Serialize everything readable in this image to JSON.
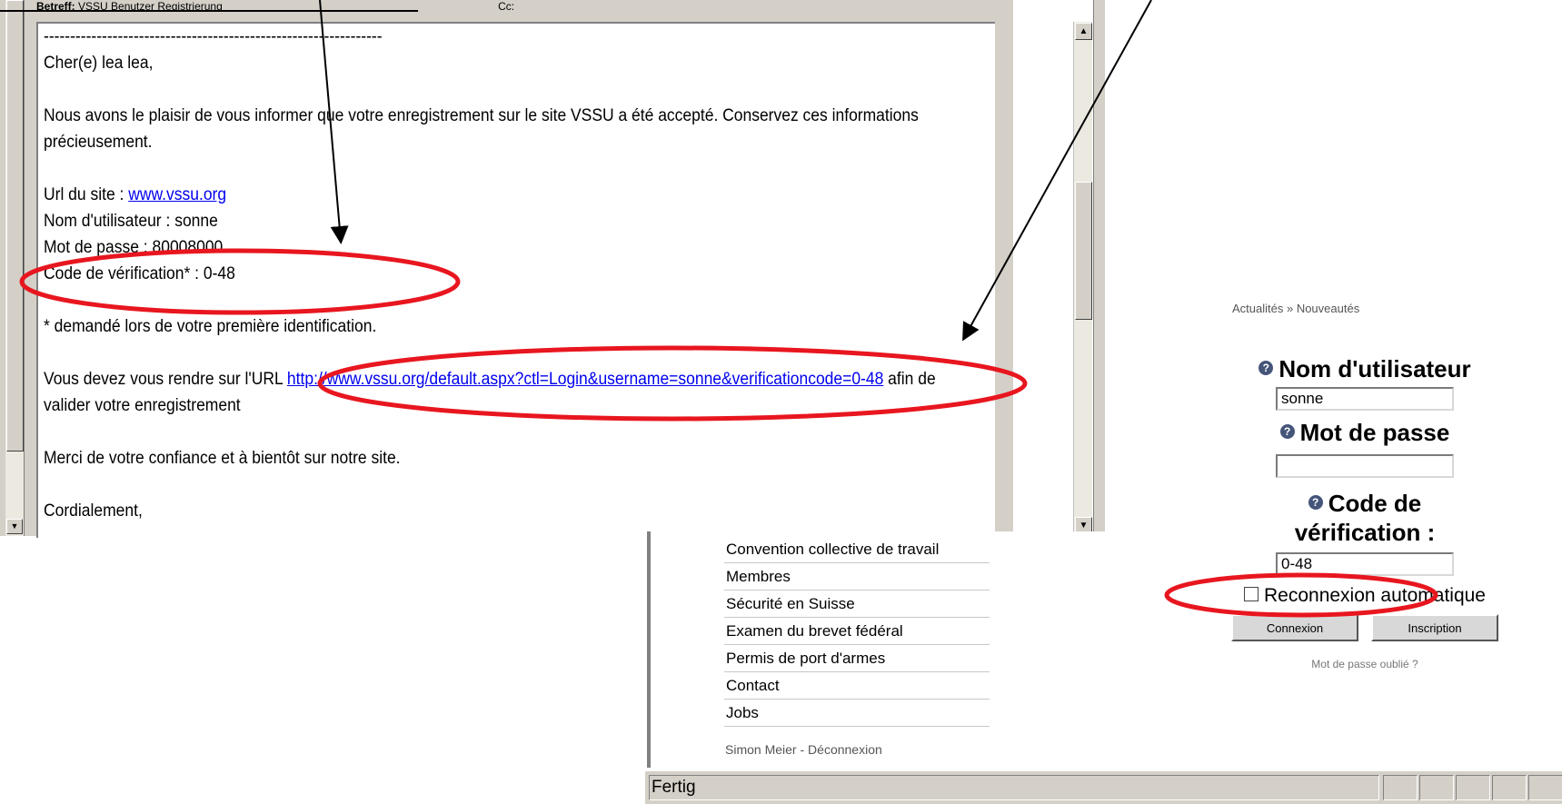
{
  "email": {
    "header_label": "Betreff:",
    "header_subject": "VSSU Benutzer Registrierung",
    "header_cc": "Cc:",
    "separator": "----------------------------------------------------------------",
    "greeting": "Cher(e) lea lea,",
    "para1_line1": "Nous avons le plaisir de vous informer que votre enregistrement sur le site VSSU a été accepté. Conservez ces informations",
    "para1_line2": "précieusement.",
    "url_label": "Url du site : ",
    "url_link": "www.vssu.org",
    "username_line": "Nom d'utilisateur : sonne",
    "password_line": "Mot de passe : 80008000",
    "code_line": "Code de vérification* : 0-48",
    "footnote": "* demandé lors de votre première identification.",
    "para2_prefix": "Vous devez vous rendre sur l'URL ",
    "para2_link": "http://www.vssu.org/default.aspx?ctl=Login&username=sonne&verificationcode=0-48",
    "para2_suffix": " afin de",
    "para2_line2": "valider votre enregistrement",
    "thanks": "Merci de votre confiance et à bientôt sur notre site.",
    "closing": "Cordialement,"
  },
  "nav": {
    "items": [
      {
        "label": "Convention collective de travail"
      },
      {
        "label": "Membres"
      },
      {
        "label": "Sécurité en Suisse"
      },
      {
        "label": "Examen du brevet fédéral"
      },
      {
        "label": "Permis de port d'armes"
      },
      {
        "label": "Contact"
      },
      {
        "label": "Jobs"
      }
    ],
    "user_name": "Simon Meier",
    "separator": " - ",
    "logout": "Déconnexion"
  },
  "status": {
    "text": "Fertig"
  },
  "login": {
    "breadcrumb": "Actualités » Nouveautés",
    "username_label": "Nom d'utilisateur",
    "username_value": "sonne",
    "password_label": "Mot de passe",
    "password_value": "",
    "code_label_line1": "Code de",
    "code_label_line2": "vérification :",
    "code_value": "0-48",
    "remember_label": "Reconnexion automatique",
    "login_button": "Connexion",
    "register_button": "Inscription",
    "forgot_link": "Mot de passe oublié ?"
  },
  "colors": {
    "annotation": "#e8161f",
    "link": "#0000ee",
    "help_icon": "#45557a"
  }
}
